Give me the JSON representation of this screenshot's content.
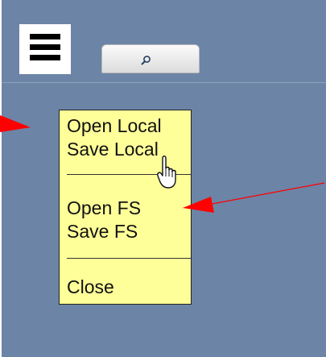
{
  "toolbar": {
    "menu_icon": "hamburger-icon",
    "search_icon": "search-icon"
  },
  "popup_menu": {
    "items": [
      {
        "label": "Open Local"
      },
      {
        "label": "Save Local"
      },
      {
        "label": "Open FS"
      },
      {
        "label": "Save FS"
      },
      {
        "label": "Close"
      }
    ]
  },
  "annotations": {
    "arrow_color": "#ff0000",
    "cursor_icon": "hand-pointer-icon"
  },
  "colors": {
    "panel_background": "#6c84a6",
    "menu_background": "#ffff99"
  }
}
